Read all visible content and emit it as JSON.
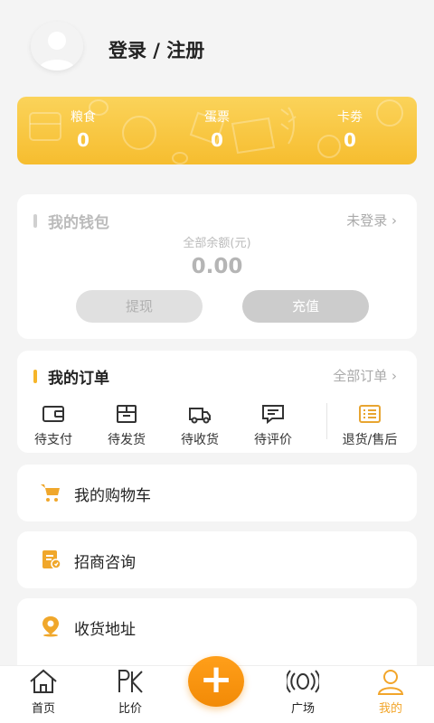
{
  "profile": {
    "login_text": "登录 / 注册"
  },
  "points": [
    {
      "label": "粮食",
      "value": "0"
    },
    {
      "label": "蛋票",
      "value": "0"
    },
    {
      "label": "卡劵",
      "value": "0"
    }
  ],
  "wallet": {
    "title": "我的钱包",
    "status": "未登录 ›",
    "balance_label": "全部余额(元)",
    "balance": "0.00",
    "withdraw_label": "提现",
    "recharge_label": "充值"
  },
  "orders": {
    "title": "我的订单",
    "all_label": "全部订单 ›",
    "items": [
      {
        "label": "待支付",
        "icon": "wallet-icon"
      },
      {
        "label": "待发货",
        "icon": "package-icon"
      },
      {
        "label": "待收货",
        "icon": "truck-icon"
      },
      {
        "label": "待评价",
        "icon": "comment-icon"
      },
      {
        "label": "退货/售后",
        "icon": "return-list-icon"
      }
    ]
  },
  "menu": [
    {
      "label": "我的购物车",
      "icon": "cart-icon"
    },
    {
      "label": "招商咨询",
      "icon": "document-icon"
    },
    {
      "label": "收货地址",
      "icon": "location-icon"
    }
  ],
  "tabbar": {
    "items": [
      {
        "label": "首页",
        "icon": "home-icon"
      },
      {
        "label": "比价",
        "icon": "pk-icon"
      },
      {
        "label": "广场",
        "icon": "broadcast-icon"
      },
      {
        "label": "我的",
        "icon": "user-icon",
        "active": true
      }
    ],
    "plus_label": "+"
  },
  "colors": {
    "accent": "#f6bd2f",
    "orange": "#f28a06",
    "active_tab": "#f2a52a"
  }
}
